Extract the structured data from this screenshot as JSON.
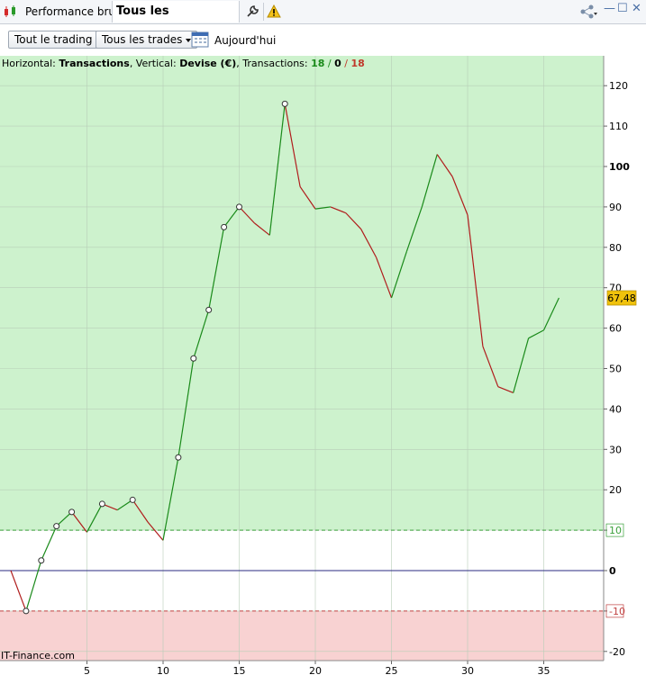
{
  "tabs": {
    "performance": "Performance brute",
    "instruments": "Tous les instruments"
  },
  "toolbar": {
    "trading": "Tout le trading",
    "trades": "Tous les trades",
    "today": "Aujourd'hui"
  },
  "info": {
    "h_label": "Horizontal: ",
    "h_value": "Transactions",
    "v_label": ", Vertical: ",
    "v_value": "Devise (€)",
    "t_label": ", Transactions: ",
    "t_win": "18",
    "slash1": " / ",
    "t_zero": "0",
    "slash2": " / ",
    "t_loss": "18"
  },
  "watermark": "IT-Finance.com",
  "colors": {
    "up": "#1a8a1a",
    "down": "#b01c1c",
    "profit_zone": "#cdf2cd",
    "loss_zone": "#f8d2d2",
    "last_badge": "#f0c20c"
  },
  "chart_data": {
    "type": "line",
    "xlabel": "",
    "ylabel": "",
    "x_ticks": [
      "5",
      "10",
      "15",
      "20",
      "25",
      "30",
      "35"
    ],
    "y_ticks": [
      "120",
      "110",
      "100",
      "90",
      "80",
      "70",
      "60",
      "50",
      "40",
      "30",
      "20",
      "10",
      "0",
      "-10",
      "-20"
    ],
    "ylim": [
      -22,
      128
    ],
    "xlim": [
      0,
      38
    ],
    "threshold_upper": 10,
    "threshold_lower": -10,
    "last_value": "67,48",
    "series": [
      {
        "x": [
          0,
          1,
          2,
          3,
          4,
          5,
          6,
          7,
          8,
          9,
          10,
          11,
          12,
          13,
          14,
          15,
          16,
          17,
          18,
          19,
          20,
          21,
          22,
          23,
          24,
          25,
          26,
          27,
          28,
          29,
          30,
          31,
          32,
          33,
          34,
          35,
          36
        ],
        "y": [
          0,
          -10,
          2.5,
          11,
          14.5,
          9.5,
          16.5,
          15,
          17.5,
          12,
          7.5,
          28,
          52.5,
          64.5,
          85,
          90,
          86,
          83,
          115.5,
          95,
          89.5,
          90,
          88.5,
          84.5,
          77.5,
          67.5,
          79,
          90,
          103,
          97.5,
          88,
          55.5,
          45.5,
          44,
          57.5,
          59.5,
          67.48
        ],
        "markers": [
          1,
          2,
          3,
          4,
          6,
          8,
          11,
          12,
          13,
          14,
          15,
          18
        ]
      }
    ]
  }
}
